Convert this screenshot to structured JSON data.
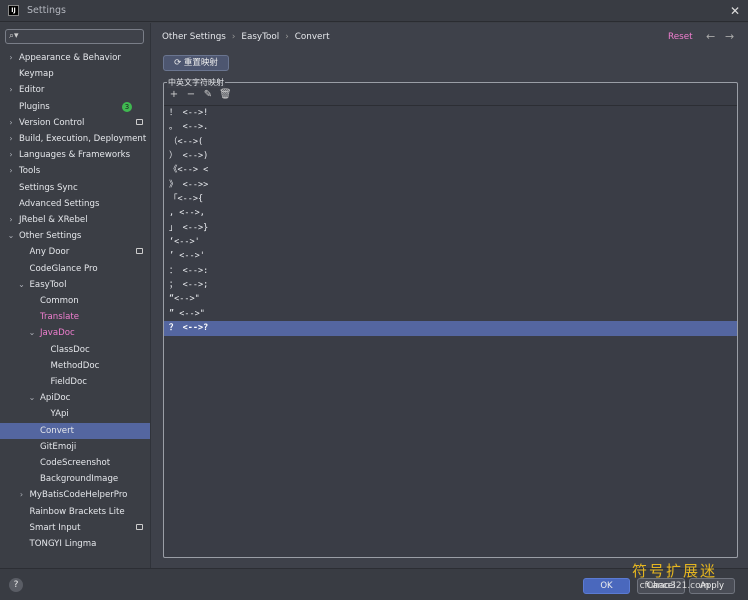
{
  "window": {
    "title": "Settings",
    "logo": "IJ"
  },
  "search": {
    "icon": "search-icon",
    "placeholder": ""
  },
  "sidebar": [
    {
      "label": "Appearance & Behavior",
      "level": 0,
      "arrow": "›"
    },
    {
      "label": "Keymap",
      "level": 0
    },
    {
      "label": "Editor",
      "level": 0,
      "arrow": "›"
    },
    {
      "label": "Plugins",
      "level": 0,
      "badge": "3"
    },
    {
      "label": "Version Control",
      "level": 0,
      "arrow": "›",
      "mark": true
    },
    {
      "label": "Build, Execution, Deployment",
      "level": 0,
      "arrow": "›"
    },
    {
      "label": "Languages & Frameworks",
      "level": 0,
      "arrow": "›"
    },
    {
      "label": "Tools",
      "level": 0,
      "arrow": "›"
    },
    {
      "label": "Settings Sync",
      "level": 0
    },
    {
      "label": "Advanced Settings",
      "level": 0
    },
    {
      "label": "JRebel & XRebel",
      "level": 0,
      "arrow": "›"
    },
    {
      "label": "Other Settings",
      "level": 0,
      "arrow": "⌄"
    },
    {
      "label": "Any Door",
      "level": 1,
      "mark": true
    },
    {
      "label": "CodeGlance Pro",
      "level": 1
    },
    {
      "label": "EasyTool",
      "level": 1,
      "arrow": "⌄"
    },
    {
      "label": "Common",
      "level": 2
    },
    {
      "label": "Translate",
      "level": 2,
      "pink": true
    },
    {
      "label": "JavaDoc",
      "level": 2,
      "arrow": "⌄",
      "pink": true
    },
    {
      "label": "ClassDoc",
      "level": 3
    },
    {
      "label": "MethodDoc",
      "level": 3
    },
    {
      "label": "FieldDoc",
      "level": 3
    },
    {
      "label": "ApiDoc",
      "level": 2,
      "arrow": "⌄"
    },
    {
      "label": "YApi",
      "level": 3
    },
    {
      "label": "Convert",
      "level": 2,
      "selected": true
    },
    {
      "label": "GitEmoji",
      "level": 2
    },
    {
      "label": "CodeScreenshot",
      "level": 2
    },
    {
      "label": "BackgroundImage",
      "level": 2
    },
    {
      "label": "MyBatisCodeHelperPro",
      "level": 1,
      "arrow": "›"
    },
    {
      "label": "Rainbow Brackets Lite",
      "level": 1
    },
    {
      "label": "Smart Input",
      "level": 1,
      "mark": true
    },
    {
      "label": "TONGYI Lingma",
      "level": 1
    }
  ],
  "breadcrumb": [
    "Other Settings",
    "EasyTool",
    "Convert"
  ],
  "header": {
    "reset": "Reset"
  },
  "reset_mapping_button": "重置映射",
  "group_title": "中英文字符映射",
  "toolbar": [
    "add-icon",
    "remove-icon",
    "edit-icon",
    "delete-icon"
  ],
  "mappings": [
    "！ <-->!",
    "。 <-->.",
    "（<-->(",
    "） <-->)",
    "《<--> <",
    "》 <-->>",
    "「<-->{",
    ", <-->,",
    "」 <-->}",
    "‘<-->'",
    "’ <-->'",
    "： <-->:",
    "； <-->;",
    "“<-->\"",
    "” <-->\"",
    "？ <-->?"
  ],
  "selected_mapping": 15,
  "footer": {
    "help": "?",
    "ok": "OK",
    "cancel": "Cancel",
    "apply": "Apply"
  },
  "watermark": {
    "line1": "符号扩展迷",
    "line2": "cfuhao321.com"
  }
}
